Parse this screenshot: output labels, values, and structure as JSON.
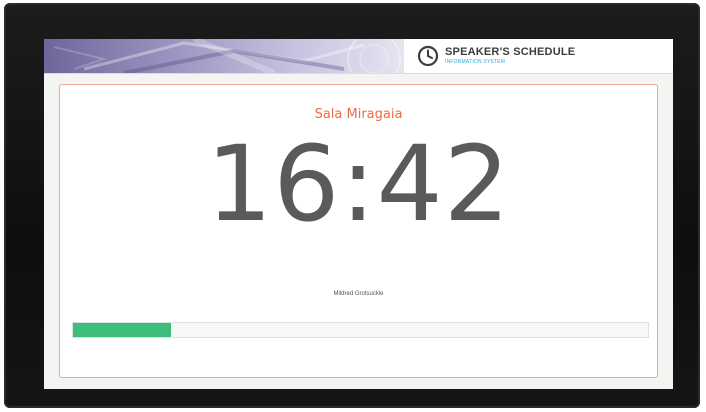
{
  "header": {
    "title": "SPEAKER'S SCHEDULE",
    "subtitle": "INFORMATION SYSTEM"
  },
  "session": {
    "room": "Sala Miragaia",
    "time": "16:42",
    "speaker": "Mildred Grotsuckle",
    "progress_percent": 17
  },
  "colors": {
    "room_text": "#ef6a45",
    "progress_fill": "#3dbd7c",
    "card_border": "#f1a796",
    "subtitle": "#2aa8d8"
  },
  "icons": {
    "brand": "clock-icon"
  }
}
